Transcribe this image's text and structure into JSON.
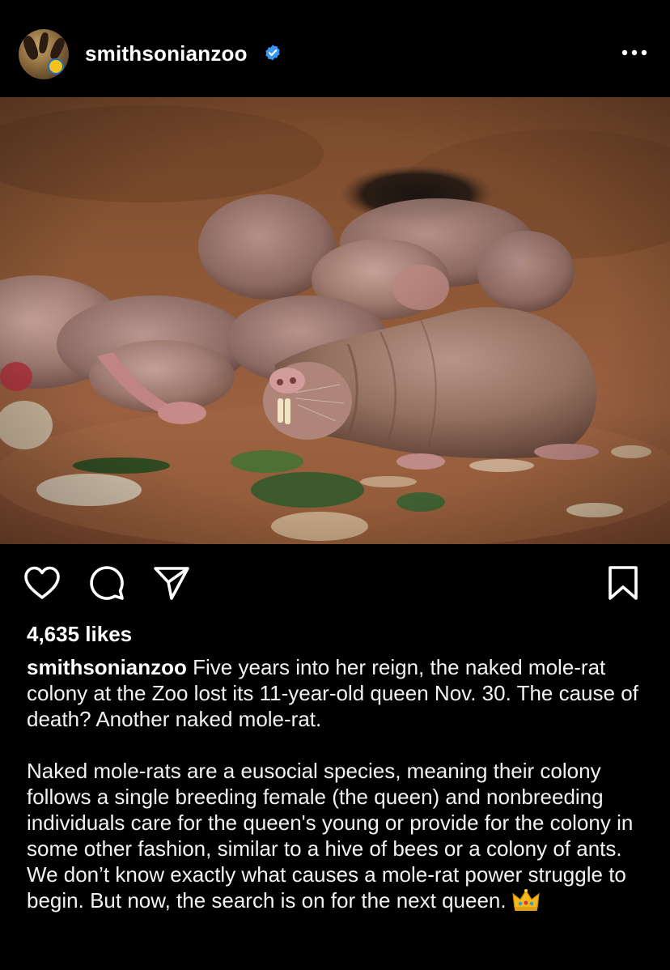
{
  "post": {
    "username": "smithsonianzoo",
    "verified": true,
    "likes": "4,635 likes",
    "caption_paragraph_1": "Five years into her reign, the naked mole-rat colony at the Zoo lost its 11-year-old queen Nov. 30. The cause of death? Another naked mole-rat.",
    "caption_paragraph_2": "Naked mole-rats are a eusocial species, meaning their colony follows a single breeding female (the queen) and nonbreeding individuals care for the queen's young or provide for the colony in some other fashion, similar to a hive of bees or a colony of ants. We don’t know exactly what causes a mole-rat power struggle to begin. But now, the search is on for the next queen."
  },
  "icons": {
    "avatar": "zoo-logo-avatar",
    "verified": "verified-badge-icon",
    "more": "more-options-icon",
    "like": "heart-icon",
    "comment": "comment-icon",
    "share": "paper-plane-icon",
    "save": "bookmark-icon",
    "emoji": "crown-emoji"
  },
  "colors": {
    "background": "#000000",
    "text": "#ffffff",
    "verified_blue": "#3897f0"
  }
}
